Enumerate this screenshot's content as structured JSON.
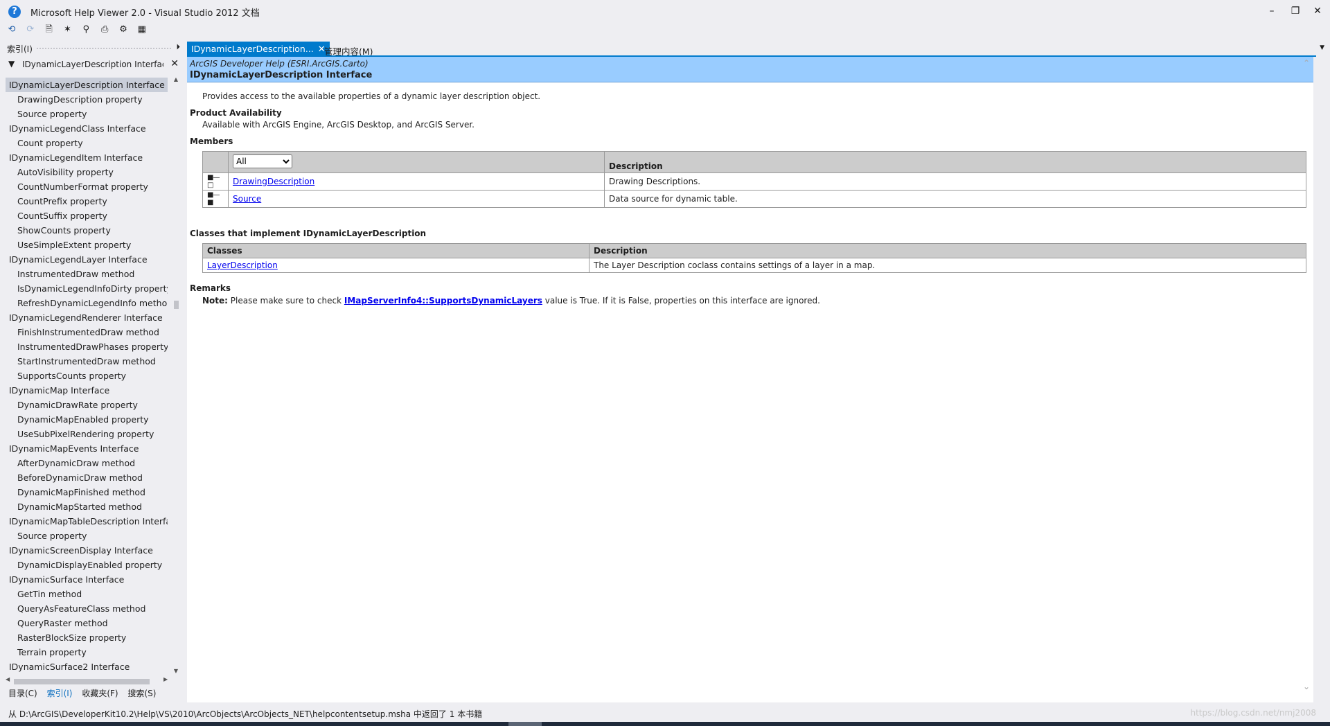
{
  "window": {
    "title": "Microsoft Help Viewer 2.0 - Visual Studio 2012 文档",
    "app_icon": "help-question-icon",
    "controls": [
      "minimize",
      "restore",
      "close"
    ]
  },
  "toolbar": {
    "icons": [
      "back-icon",
      "forward-icon",
      "add-to-bookmarks-icon",
      "bookmark-star-icon",
      "find-in-topic-icon",
      "print-icon",
      "settings-icon",
      "manage-content-icon"
    ]
  },
  "left_pane": {
    "title": "索引(I)",
    "filter_value": "IDynamicLayerDescription Interface",
    "items": [
      {
        "label": "IDynamicLayerDescription Interface",
        "level": 1,
        "selected": true
      },
      {
        "label": "DrawingDescription property",
        "level": 2
      },
      {
        "label": "Source property",
        "level": 2
      },
      {
        "label": "IDynamicLegendClass Interface",
        "level": 1
      },
      {
        "label": "Count property",
        "level": 2
      },
      {
        "label": "IDynamicLegendItem Interface",
        "level": 1
      },
      {
        "label": "AutoVisibility property",
        "level": 2
      },
      {
        "label": "CountNumberFormat property",
        "level": 2
      },
      {
        "label": "CountPrefix property",
        "level": 2
      },
      {
        "label": "CountSuffix property",
        "level": 2
      },
      {
        "label": "ShowCounts property",
        "level": 2
      },
      {
        "label": "UseSimpleExtent property",
        "level": 2
      },
      {
        "label": "IDynamicLegendLayer Interface",
        "level": 1
      },
      {
        "label": "InstrumentedDraw method",
        "level": 2
      },
      {
        "label": "IsDynamicLegendInfoDirty property",
        "level": 2
      },
      {
        "label": "RefreshDynamicLegendInfo method",
        "level": 2
      },
      {
        "label": "IDynamicLegendRenderer Interface",
        "level": 1
      },
      {
        "label": "FinishInstrumentedDraw method",
        "level": 2
      },
      {
        "label": "InstrumentedDrawPhases property",
        "level": 2
      },
      {
        "label": "StartInstrumentedDraw method",
        "level": 2
      },
      {
        "label": "SupportsCounts property",
        "level": 2
      },
      {
        "label": "IDynamicMap Interface",
        "level": 1
      },
      {
        "label": "DynamicDrawRate property",
        "level": 2
      },
      {
        "label": "DynamicMapEnabled property",
        "level": 2
      },
      {
        "label": "UseSubPixelRendering property",
        "level": 2
      },
      {
        "label": "IDynamicMapEvents Interface",
        "level": 1
      },
      {
        "label": "AfterDynamicDraw method",
        "level": 2
      },
      {
        "label": "BeforeDynamicDraw method",
        "level": 2
      },
      {
        "label": "DynamicMapFinished method",
        "level": 2
      },
      {
        "label": "DynamicMapStarted method",
        "level": 2
      },
      {
        "label": "IDynamicMapTableDescription Interface",
        "level": 1
      },
      {
        "label": "Source property",
        "level": 2
      },
      {
        "label": "IDynamicScreenDisplay Interface",
        "level": 1
      },
      {
        "label": "DynamicDisplayEnabled property",
        "level": 2
      },
      {
        "label": "IDynamicSurface Interface",
        "level": 1
      },
      {
        "label": "GetTin method",
        "level": 2
      },
      {
        "label": "QueryAsFeatureClass method",
        "level": 2
      },
      {
        "label": "QueryRaster method",
        "level": 2
      },
      {
        "label": "RasterBlockSize property",
        "level": 2
      },
      {
        "label": "Terrain property",
        "level": 2
      },
      {
        "label": "IDynamicSurface2 Interface",
        "level": 1
      }
    ],
    "bottom_tabs": [
      {
        "label": "目录(C)",
        "active": false
      },
      {
        "label": "索引(I)",
        "active": true
      },
      {
        "label": "收藏夹(F)",
        "active": false
      },
      {
        "label": "搜索(S)",
        "active": false
      }
    ]
  },
  "tabs": {
    "active_label": "IDynamicLayerDescription...",
    "other_label": "管理内容(M)"
  },
  "topic": {
    "banner_subtitle": "ArcGIS Developer Help (ESRI.ArcGIS.Carto)",
    "banner_title": "IDynamicLayerDescription Interface",
    "summary": "Provides access to the available properties of a dynamic layer description object.",
    "product_availability_heading": "Product Availability",
    "product_availability_text": "Available with ArcGIS Engine, ArcGIS Desktop, and ArcGIS Server.",
    "members_heading": "Members",
    "members_filter": "All",
    "members_filter_options": [
      "All"
    ],
    "members_description_header": "Description",
    "members": [
      {
        "name": "DrawingDescription",
        "description": "Drawing Descriptions.",
        "icon": "read-write-property-icon"
      },
      {
        "name": "Source",
        "description": "Data source for dynamic table.",
        "icon": "read-write-property-icon"
      }
    ],
    "classes_heading": "Classes that implement IDynamicLayerDescription",
    "classes_header": "Classes",
    "classes_description_header": "Description",
    "classes": [
      {
        "name": "LayerDescription",
        "description": "The Layer Description coclass contains settings of a layer in a map."
      }
    ],
    "remarks_heading": "Remarks",
    "remarks_note_label": "Note:",
    "remarks_pre": "Please make sure to check",
    "remarks_link": "IMapServerInfo4::SupportsDynamicLayers",
    "remarks_post": "value is True. If it is False, properties on this interface are ignored."
  },
  "status": {
    "text": "从 D:\\ArcGIS\\DeveloperKit10.2\\Help\\VS\\2010\\ArcObjects\\ArcObjects_NET\\helpcontentsetup.msha 中返回了 1 本书籍",
    "watermark": "https://blog.csdn.net/nmj2008"
  }
}
